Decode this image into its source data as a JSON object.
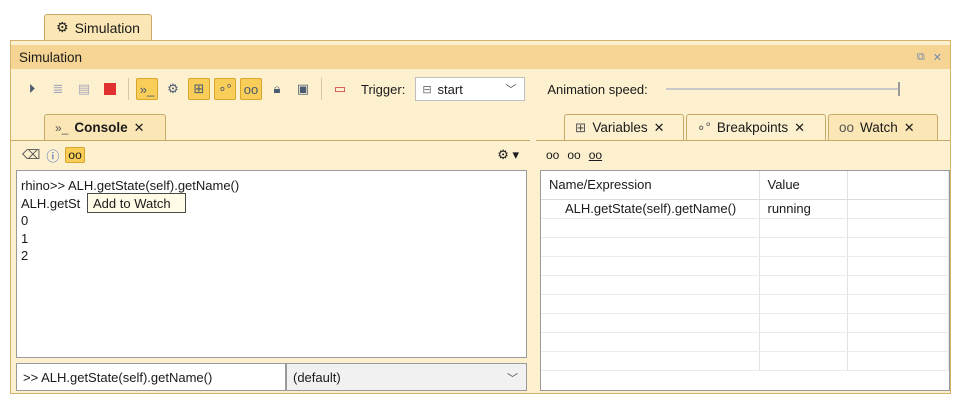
{
  "document_tab": {
    "label": "Simulation",
    "icon": "gear-icon"
  },
  "window": {
    "title": "Simulation",
    "buttons": [
      "restore-icon",
      "close-icon"
    ]
  },
  "toolbar": {
    "trigger_label": "Trigger:",
    "trigger_value": "start",
    "animation_label": "Animation speed:"
  },
  "console": {
    "tab_label": "Console",
    "tab_prefix": "»_",
    "output_lines": [
      "rhino>> ALH.getState(self).getName()",
      "ALH.getSt        e() = \"ready\"",
      "0",
      "1",
      "2"
    ],
    "tooltip": "Add to Watch",
    "input_value": ">> ALH.getState(self).getName()",
    "engine_value": "(default)"
  },
  "right_tabs": [
    {
      "label": "Variables",
      "icon": "variables-icon",
      "active": false
    },
    {
      "label": "Breakpoints",
      "icon": "breakpoints-icon",
      "active": false
    },
    {
      "label": "Watch",
      "icon": "watch-icon",
      "active": true
    }
  ],
  "watch": {
    "columns": [
      "Name/Expression",
      "Value"
    ],
    "rows": [
      {
        "name": "ALH.getState(self).getName()",
        "value": "running"
      }
    ]
  },
  "colors": {
    "accent": "#f6d594",
    "frame": "#fdf0cf",
    "highlight": "#f8cd58",
    "border": "#c9a968"
  }
}
